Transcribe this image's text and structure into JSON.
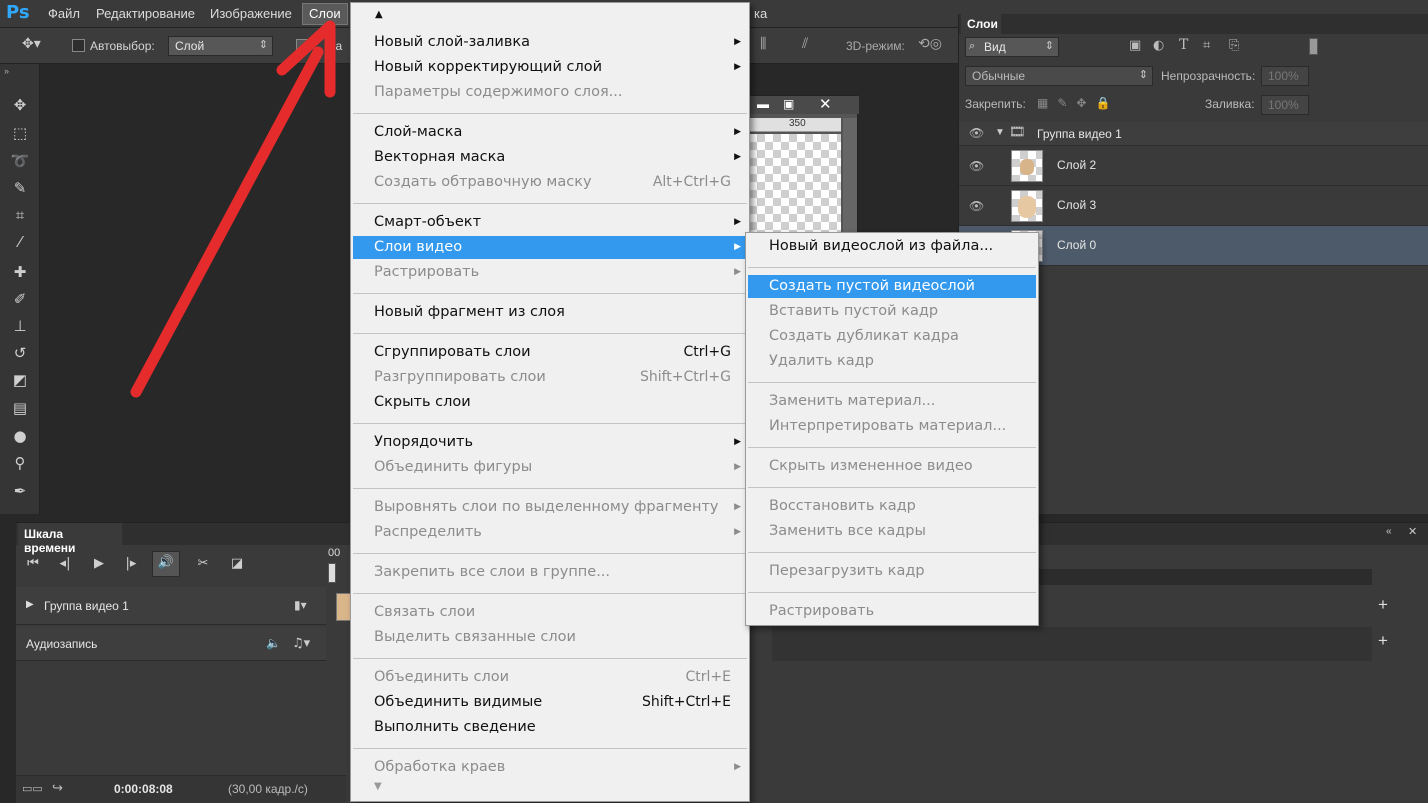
{
  "menubar": {
    "logo": "Ps",
    "items": [
      "Файл",
      "Редактирование",
      "Изображение",
      "Слои"
    ],
    "partial_right": "ка"
  },
  "options": {
    "autoselect_label": "Автовыбор:",
    "autoselect_value": "Слой",
    "partial_label": "за",
    "mode3d_label": "3D-режим:"
  },
  "doc": {
    "ruler_350": "350"
  },
  "layers_panel": {
    "title": "Слои",
    "filter_value": "Вид",
    "blend_mode": "Обычные",
    "opacity_label": "Непрозрачность:",
    "opacity_value": "100%",
    "lock_label": "Закрепить:",
    "fill_label": "Заливка:",
    "fill_value": "100%",
    "layers": [
      {
        "name": "Группа видео 1",
        "type": "group"
      },
      {
        "name": "Слой 2",
        "type": "layer"
      },
      {
        "name": "Слой 3",
        "type": "layer"
      },
      {
        "name": "Слой 0",
        "type": "layer",
        "selected": true
      }
    ]
  },
  "timeline": {
    "title": "Шкала времени",
    "track_group": "Группа видео 1",
    "track_audio": "Аудиозапись",
    "time_marker": "00",
    "timecode": "0:00:08:08",
    "fps": "(30,00 кадр./с)"
  },
  "layer_menu": {
    "items": [
      {
        "label": "Новый слой-заливка",
        "arrow": true
      },
      {
        "label": "Новый корректирующий слой",
        "arrow": true
      },
      {
        "label": "Параметры содержимого слоя...",
        "disabled": true
      },
      {
        "sep": true
      },
      {
        "label": "Слой-маска",
        "arrow": true
      },
      {
        "label": "Векторная маска",
        "arrow": true
      },
      {
        "label": "Создать обтравочную маску",
        "shortcut": "Alt+Ctrl+G",
        "disabled": true
      },
      {
        "sep": true
      },
      {
        "label": "Смарт-объект",
        "arrow": true
      },
      {
        "label": "Слои видео",
        "arrow": true,
        "highlight": true
      },
      {
        "label": "Растрировать",
        "arrow": true,
        "disabled": true
      },
      {
        "sep": true
      },
      {
        "label": "Новый фрагмент из слоя"
      },
      {
        "sep": true
      },
      {
        "label": "Сгруппировать слои",
        "shortcut": "Ctrl+G"
      },
      {
        "label": "Разгруппировать слои",
        "shortcut": "Shift+Ctrl+G",
        "disabled": true
      },
      {
        "label": "Скрыть слои"
      },
      {
        "sep": true
      },
      {
        "label": "Упорядочить",
        "arrow": true
      },
      {
        "label": "Объединить фигуры",
        "arrow": true,
        "disabled": true
      },
      {
        "sep": true
      },
      {
        "label": "Выровнять слои по выделенному фрагменту",
        "arrow": true,
        "disabled": true
      },
      {
        "label": "Распределить",
        "arrow": true,
        "disabled": true
      },
      {
        "sep": true
      },
      {
        "label": "Закрепить все слои в группе...",
        "disabled": true
      },
      {
        "sep": true
      },
      {
        "label": "Связать слои",
        "disabled": true
      },
      {
        "label": "Выделить связанные слои",
        "disabled": true
      },
      {
        "sep": true
      },
      {
        "label": "Объединить слои",
        "shortcut": "Ctrl+E",
        "disabled": true
      },
      {
        "label": "Объединить видимые",
        "shortcut": "Shift+Ctrl+E"
      },
      {
        "label": "Выполнить сведение"
      },
      {
        "sep": true
      },
      {
        "label": "Обработка краев",
        "arrow": true,
        "disabled": true
      }
    ]
  },
  "video_submenu": {
    "items": [
      {
        "label": "Новый видеослой из файла..."
      },
      {
        "sep": true
      },
      {
        "label": "Создать пустой видеослой",
        "highlight": true
      },
      {
        "label": "Вставить пустой кадр",
        "disabled": true
      },
      {
        "label": "Создать дубликат кадра",
        "disabled": true
      },
      {
        "label": "Удалить кадр",
        "disabled": true
      },
      {
        "sep": true
      },
      {
        "label": "Заменить материал...",
        "disabled": true
      },
      {
        "label": "Интерпретировать материал...",
        "disabled": true
      },
      {
        "sep": true
      },
      {
        "label": "Скрыть измененное видео",
        "disabled": true
      },
      {
        "sep": true
      },
      {
        "label": "Восстановить кадр",
        "disabled": true
      },
      {
        "label": "Заменить все кадры",
        "disabled": true
      },
      {
        "sep": true
      },
      {
        "label": "Перезагрузить кадр",
        "disabled": true
      },
      {
        "sep": true
      },
      {
        "label": "Растрировать",
        "disabled": true
      }
    ]
  },
  "colors": {
    "highlight": "#3399ee",
    "annotation_arrow": "#e52b2b",
    "selected_layer": "#4d5a6a"
  }
}
